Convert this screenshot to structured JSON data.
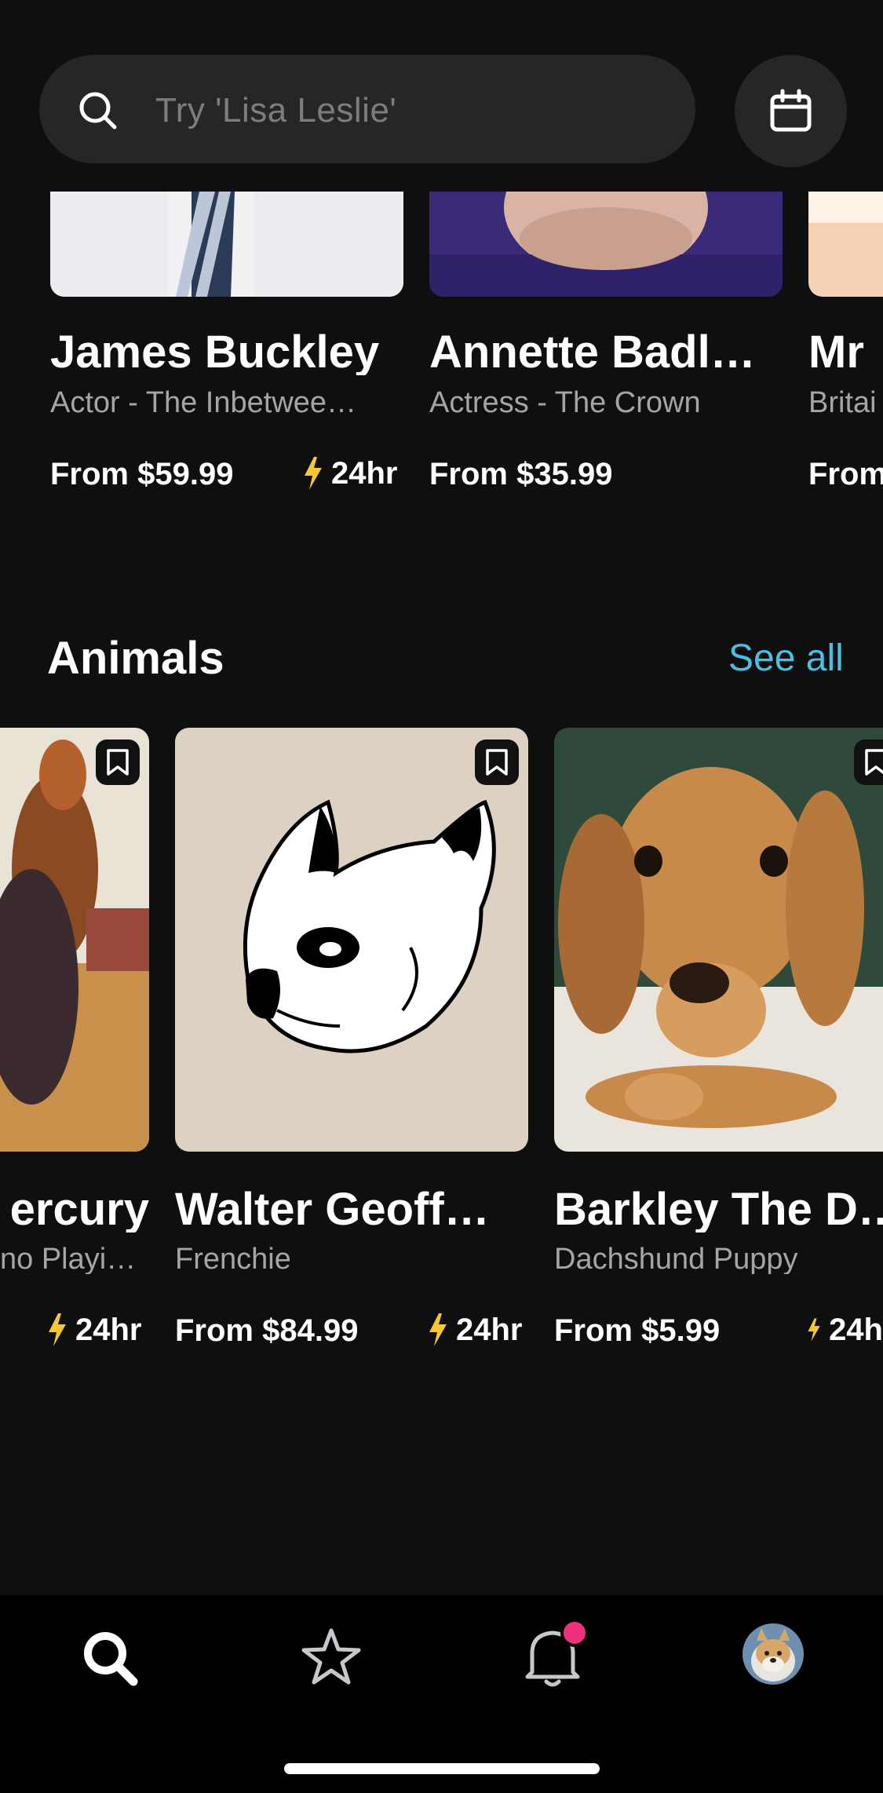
{
  "search": {
    "placeholder": "Try 'Lisa Leslie'"
  },
  "top_row": [
    {
      "name": "James Buckley",
      "subtitle": "Actor - The Inbetwee…",
      "price": "From $59.99",
      "turnaround": "24hr"
    },
    {
      "name": "Annette Badl…",
      "subtitle": "Actress - The Crown",
      "price": "From $35.99",
      "turnaround": ""
    },
    {
      "name": "Mr",
      "subtitle": "Britai",
      "price": "From",
      "turnaround": ""
    }
  ],
  "animals": {
    "title": "Animals",
    "see_all": "See all",
    "items": [
      {
        "name": "ercury",
        "subtitle": "no Playi…",
        "price": "",
        "turnaround": "24hr"
      },
      {
        "name": "Walter Geoff…",
        "subtitle": "Frenchie",
        "price": "From $84.99",
        "turnaround": "24hr"
      },
      {
        "name": "Barkley The D…",
        "subtitle": "Dachshund Puppy",
        "price": "From $5.99",
        "turnaround": "24h"
      }
    ]
  },
  "nav": {
    "items": [
      "search-icon",
      "star-icon",
      "bell-icon",
      "profile-avatar"
    ],
    "has_notification": true
  },
  "colors": {
    "accent": "#46c0e3",
    "bolt": "#f5c731",
    "notification": "#f0307a"
  }
}
